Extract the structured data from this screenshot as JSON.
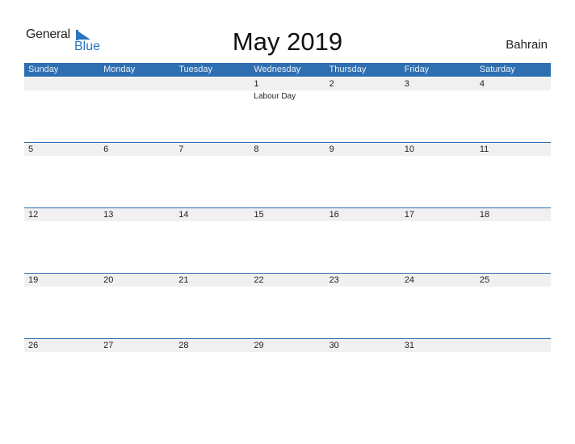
{
  "logo": {
    "line1": "General",
    "line2": "Blue",
    "icon": "logo-triangle-icon"
  },
  "title": "May 2019",
  "country": "Bahrain",
  "colors": {
    "accent": "#2e6fb1",
    "band": "#f0f0f0"
  },
  "weekdays": [
    "Sunday",
    "Monday",
    "Tuesday",
    "Wednesday",
    "Thursday",
    "Friday",
    "Saturday"
  ],
  "weeks": [
    [
      {
        "day": ""
      },
      {
        "day": ""
      },
      {
        "day": ""
      },
      {
        "day": "1",
        "event": "Labour Day"
      },
      {
        "day": "2"
      },
      {
        "day": "3"
      },
      {
        "day": "4"
      }
    ],
    [
      {
        "day": "5"
      },
      {
        "day": "6"
      },
      {
        "day": "7"
      },
      {
        "day": "8"
      },
      {
        "day": "9"
      },
      {
        "day": "10"
      },
      {
        "day": "11"
      }
    ],
    [
      {
        "day": "12"
      },
      {
        "day": "13"
      },
      {
        "day": "14"
      },
      {
        "day": "15"
      },
      {
        "day": "16"
      },
      {
        "day": "17"
      },
      {
        "day": "18"
      }
    ],
    [
      {
        "day": "19"
      },
      {
        "day": "20"
      },
      {
        "day": "21"
      },
      {
        "day": "22"
      },
      {
        "day": "23"
      },
      {
        "day": "24"
      },
      {
        "day": "25"
      }
    ],
    [
      {
        "day": "26"
      },
      {
        "day": "27"
      },
      {
        "day": "28"
      },
      {
        "day": "29"
      },
      {
        "day": "30"
      },
      {
        "day": "31"
      },
      {
        "day": ""
      }
    ]
  ]
}
